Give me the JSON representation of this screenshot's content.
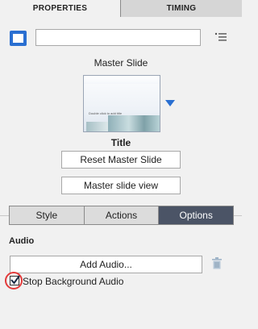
{
  "tabs": [
    {
      "label": "PROPERTIES",
      "active": true
    },
    {
      "label": "TIMING",
      "active": false
    }
  ],
  "header": {
    "name_value": "",
    "icon": "slide-icon",
    "menu_icon": "list-menu-icon"
  },
  "master": {
    "label": "Master Slide",
    "thumbnail_caption": "Double click to add title",
    "layout_title": "Title",
    "reset_label": "Reset Master Slide",
    "view_label": "Master slide view"
  },
  "segments": [
    {
      "label": "Style",
      "active": false
    },
    {
      "label": "Actions",
      "active": false
    },
    {
      "label": "Options",
      "active": true
    }
  ],
  "audio": {
    "section_title": "Audio",
    "add_label": "Add Audio...",
    "stop_bg_label": "Stop Background Audio",
    "stop_bg_checked": true
  },
  "colors": {
    "accent": "#2a6fd1",
    "segment_active": "#4b5466",
    "highlight_ring": "#e23b3b"
  }
}
